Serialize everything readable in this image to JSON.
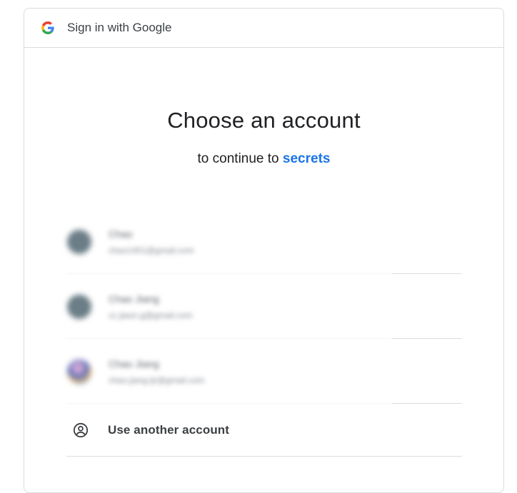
{
  "header": {
    "logo_icon": "google-g-icon",
    "title": "Sign in with Google"
  },
  "main": {
    "title": "Choose an account",
    "subtitle_prefix": "to continue to",
    "app_name": "secrets",
    "accounts": [
      {
        "name": "Chao",
        "email": "chao1401@gmail.com",
        "avatar": "initial-avatar"
      },
      {
        "name": "Chao Jiang",
        "email": "cc.jiaon.g@gmail.com",
        "avatar": "initial-avatar"
      },
      {
        "name": "Chao Jiang",
        "email": "chao.jiang.ljr@gmail.com",
        "avatar": "photo-avatar"
      }
    ],
    "use_another": {
      "label": "Use another account",
      "icon": "account-circle-icon"
    }
  },
  "colors": {
    "link": "#1a73e8",
    "border": "#dadce0",
    "text": "#202124"
  }
}
